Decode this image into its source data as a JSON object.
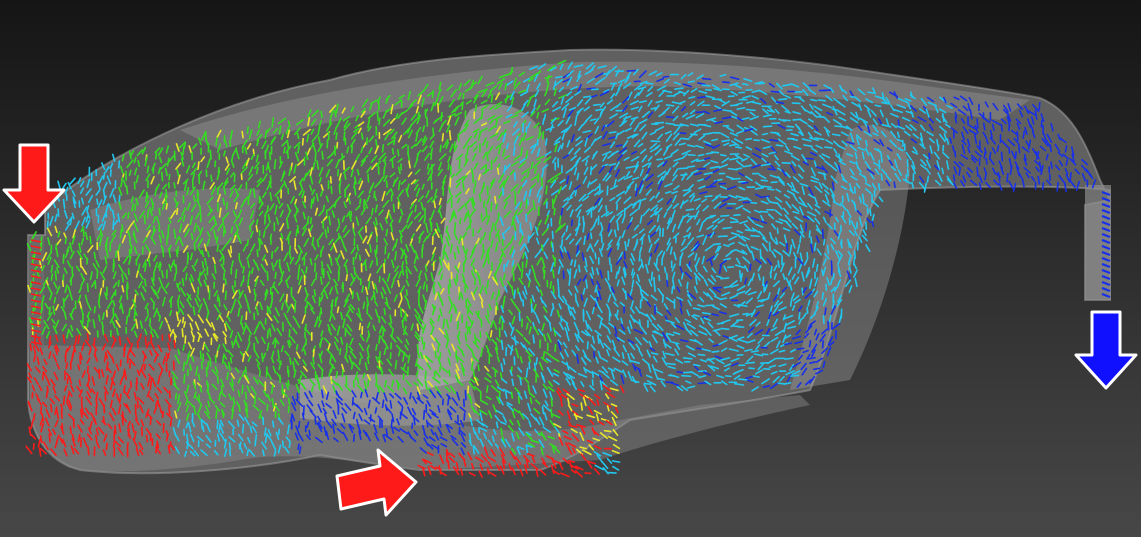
{
  "scene": {
    "description_colors": {
      "background_top": "#151515",
      "background_bottom": "#474747",
      "cabin_shell": "#8a8a8a",
      "seat": "#b4b4b4"
    },
    "velocity_scale": {
      "low": "#1730e8",
      "mid_low": "#20c8f0",
      "mid": "#33dd22",
      "mid_high": "#e8e82a",
      "high": "#ff1a1a"
    },
    "inlets": [
      {
        "id": "front-inlet",
        "color": "#ff1a1a",
        "direction": "down",
        "icon": "arrow-down-icon"
      },
      {
        "id": "floor-inlet",
        "color": "#ff1a1a",
        "direction": "right",
        "icon": "arrow-right-icon"
      }
    ],
    "outlets": [
      {
        "id": "rear-outlet",
        "color": "#1010ff",
        "direction": "down",
        "icon": "arrow-down-icon"
      }
    ]
  }
}
